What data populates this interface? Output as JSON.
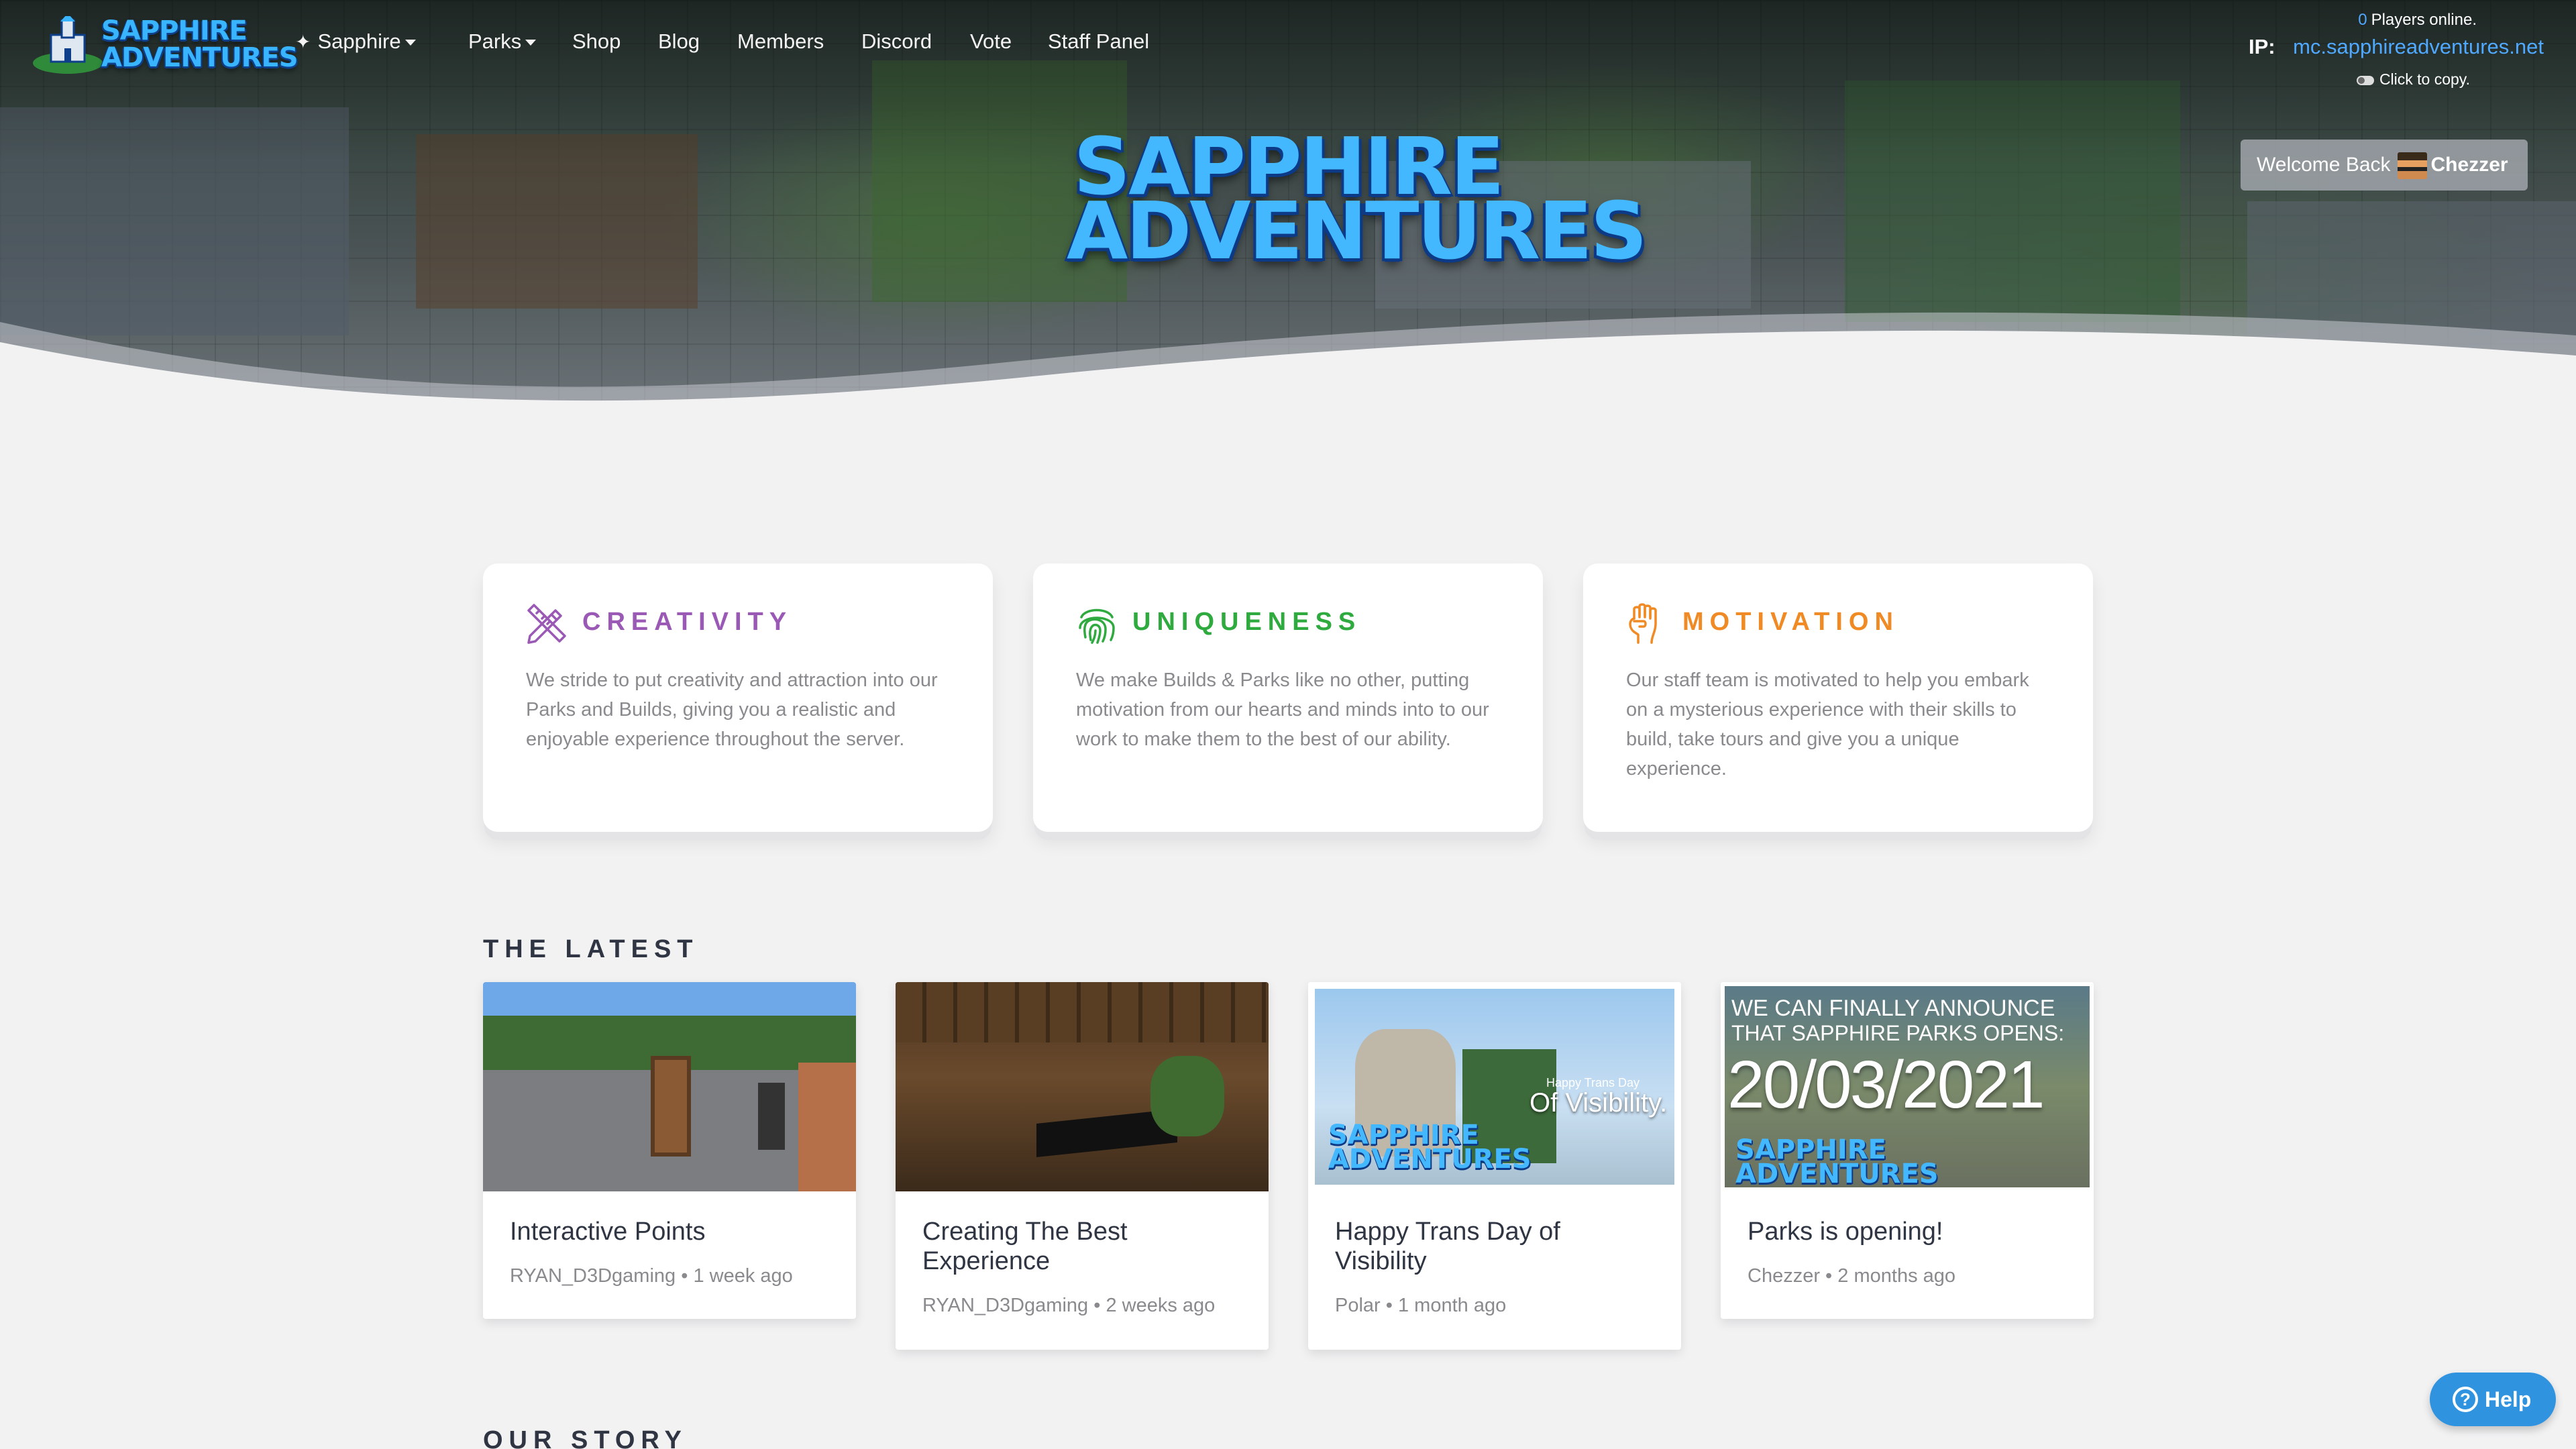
{
  "nav": {
    "logo_text_line1": "SAPPHIRE",
    "logo_text_line2": "ADVENTURES",
    "links": [
      {
        "label": "Sapphire",
        "has_dropdown": true,
        "icon": "sparkle-icon"
      },
      {
        "label": "Parks",
        "has_dropdown": true
      },
      {
        "label": "Shop"
      },
      {
        "label": "Blog"
      },
      {
        "label": "Members"
      },
      {
        "label": "Discord"
      },
      {
        "label": "Vote"
      },
      {
        "label": "Staff Panel"
      }
    ]
  },
  "server": {
    "players_count": "0",
    "players_label": "Players online.",
    "ip_label": "IP:",
    "ip_address": "mc.sapphireadventures.net",
    "copy_hint": "Click to copy."
  },
  "welcome": {
    "prefix": "Welcome Back",
    "username": "Chezzer"
  },
  "hero": {
    "title_line1": "SAPPHIRE",
    "title_line2": "ADVENTURES"
  },
  "values": [
    {
      "title": "CREATIVITY",
      "icon": "pencil-ruler-icon",
      "color": "#9b59b6",
      "body": "We stride to put creativity and attraction into our Parks and Builds, giving you a realistic and enjoyable experience throughout the server."
    },
    {
      "title": "UNIQUENESS",
      "icon": "fingerprint-icon",
      "color": "#2eaa3f",
      "body": "We make Builds & Parks like no other, putting motivation from our hearts and minds into to our work to make them to the best of our ability."
    },
    {
      "title": "MOTIVATION",
      "icon": "raised-fist-icon",
      "color": "#f08a24",
      "body": "Our staff team is motivated to help you embark on a mysterious experience with their skills to build, take tours and give you a unique experience."
    }
  ],
  "latest": {
    "heading": "THE LATEST",
    "posts": [
      {
        "title": "Interactive Points",
        "author": "RYAN_D3Dgaming",
        "time": "1 week ago"
      },
      {
        "title": "Creating The Best Experience",
        "author": "RYAN_D3Dgaming",
        "time": "2 weeks ago"
      },
      {
        "title": "Happy Trans Day of Visibility",
        "author": "Polar",
        "time": "1 month ago",
        "thumb_caption": "Happy Trans Day",
        "thumb_caption2": "Of Visibility.",
        "thumb_logo1": "SAPPHIRE",
        "thumb_logo2": "ADVENTURES"
      },
      {
        "title": "Parks is opening!",
        "author": "Chezzer",
        "time": "2 months ago",
        "thumb_line1": "WE CAN FINALLY ANNOUNCE",
        "thumb_line2": "THAT SAPPHIRE PARKS OPENS:",
        "thumb_date": "20/03/2021",
        "thumb_logo1": "SAPPHIRE",
        "thumb_logo2": "ADVENTURES"
      }
    ],
    "meta_separator": " • "
  },
  "story": {
    "heading": "OUR STORY"
  },
  "help": {
    "label": "Help",
    "icon_glyph": "?"
  },
  "colors": {
    "accent_blue": "#4fa9ff",
    "help_button": "#2f93e0",
    "page_bg": "#f2f2f3"
  }
}
